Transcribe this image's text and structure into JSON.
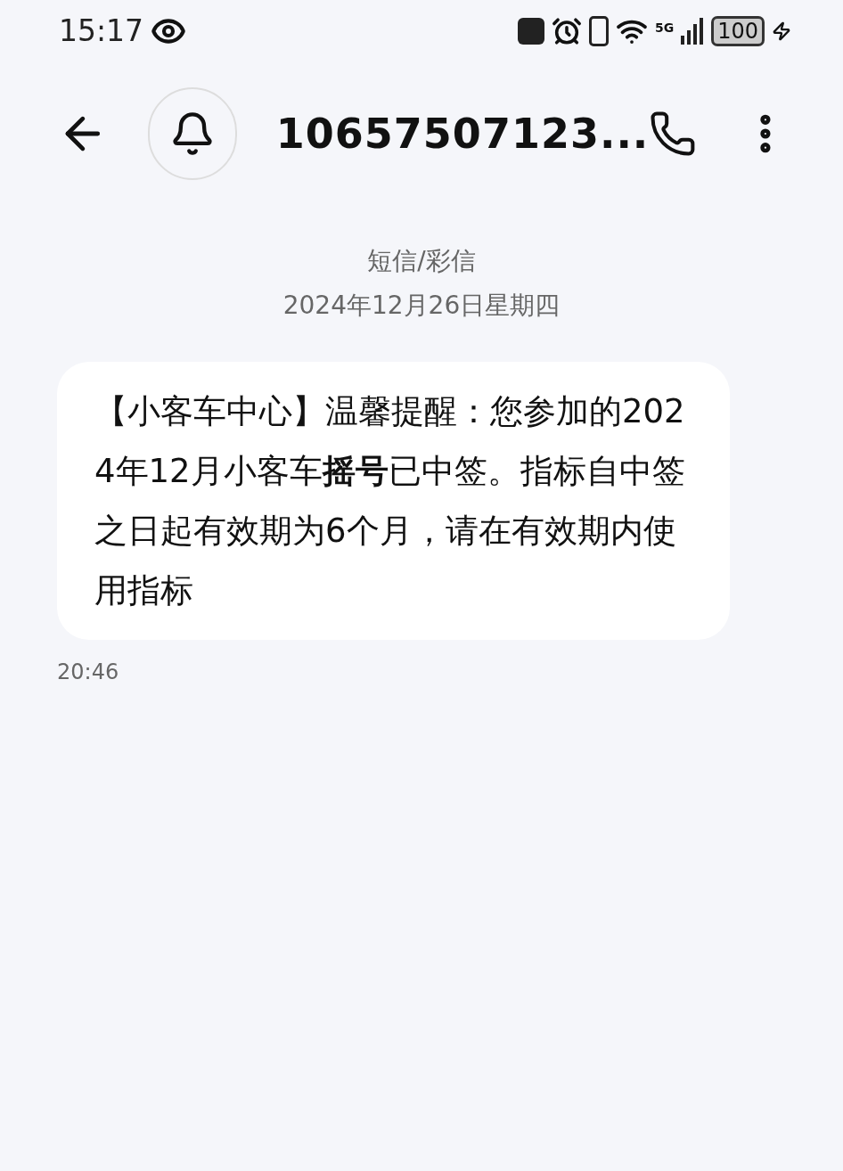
{
  "status_bar": {
    "time": "15:17",
    "network": "5G",
    "battery": "100"
  },
  "header": {
    "title": "10657507123..."
  },
  "conversation": {
    "type_label": "短信/彩信",
    "date": "2024年12月26日星期四"
  },
  "messages": [
    {
      "text": "【小客车中心】温馨提醒：您参加的2024年12月小客车**摇号**已中签。指标自中签之日起有效期为6个月，请在有效期内使用指标",
      "time": "20:46"
    }
  ]
}
